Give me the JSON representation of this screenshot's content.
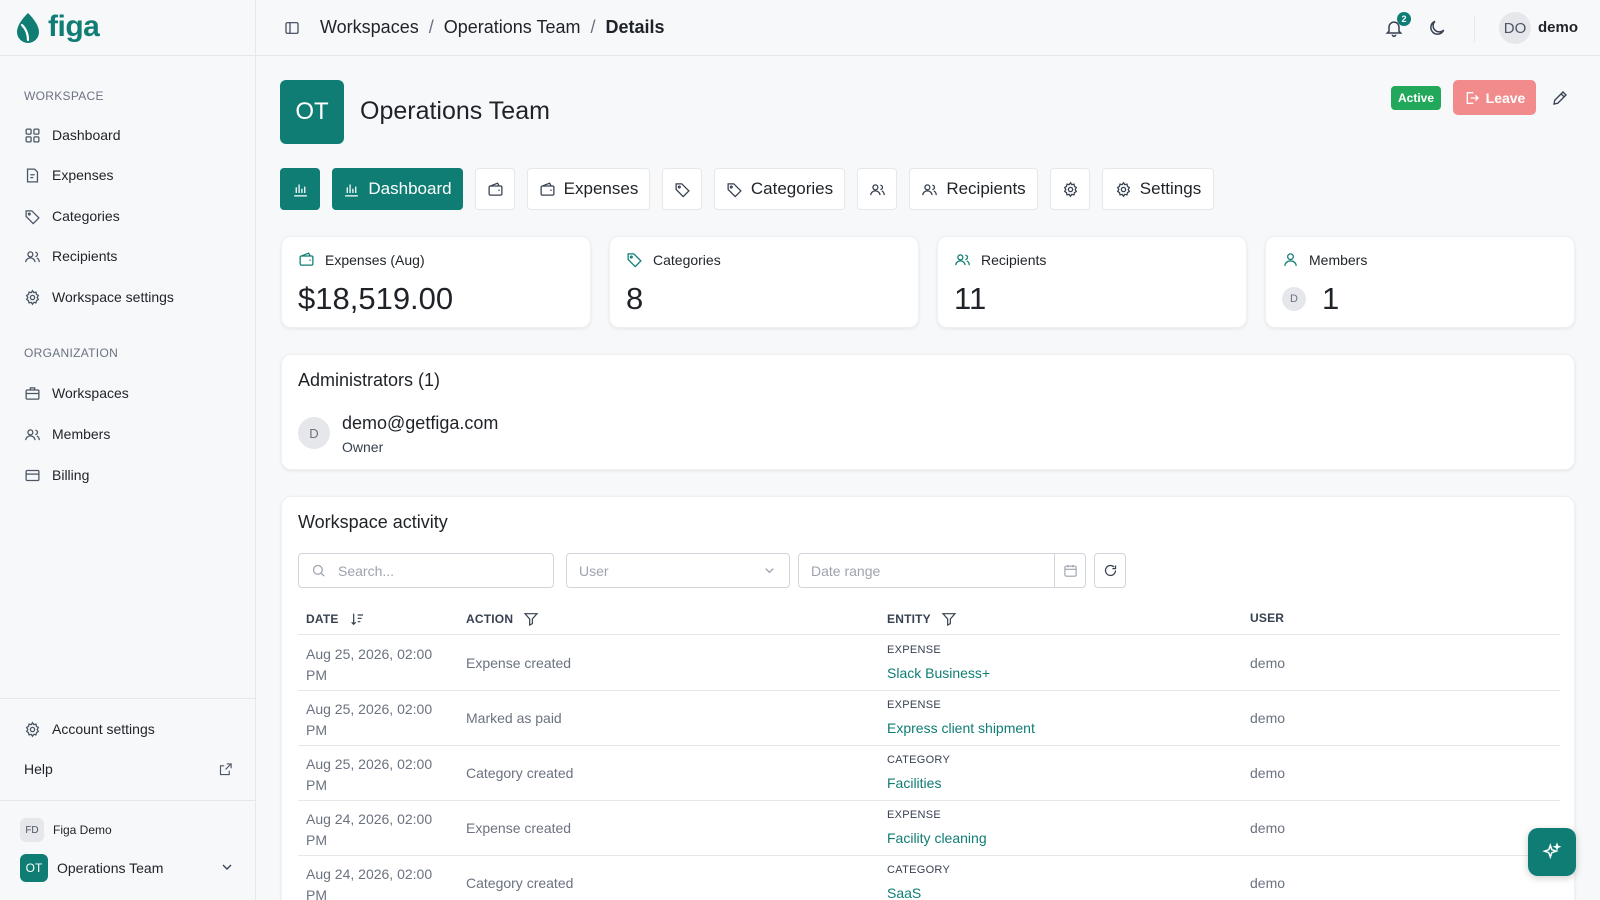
{
  "app": {
    "name": "figa"
  },
  "sidebar": {
    "workspace_section": "WORKSPACE",
    "workspace_items": [
      {
        "label": "Dashboard",
        "icon": "grid-icon"
      },
      {
        "label": "Expenses",
        "icon": "receipt-icon"
      },
      {
        "label": "Categories",
        "icon": "tag-icon"
      },
      {
        "label": "Recipients",
        "icon": "users-icon"
      },
      {
        "label": "Workspace settings",
        "icon": "gear-icon"
      }
    ],
    "organization_section": "ORGANIZATION",
    "organization_items": [
      {
        "label": "Workspaces",
        "icon": "briefcase-icon"
      },
      {
        "label": "Members",
        "icon": "users-icon"
      },
      {
        "label": "Billing",
        "icon": "credit-card-icon"
      }
    ],
    "account_settings": "Account settings",
    "help": "Help",
    "org": {
      "initials": "FD",
      "name": "Figa Demo"
    },
    "current_workspace": {
      "initials": "OT",
      "name": "Operations Team"
    }
  },
  "topbar": {
    "breadcrumbs": [
      "Workspaces",
      "Operations Team",
      "Details"
    ],
    "separator": "/",
    "notification_count": "2",
    "user_initials": "DO",
    "user_name": "demo"
  },
  "header": {
    "initials": "OT",
    "title": "Operations Team",
    "status": "Active",
    "leave_label": "Leave"
  },
  "tabs": [
    {
      "label": "Dashboard",
      "active": true
    },
    {
      "label": "Expenses",
      "active": false
    },
    {
      "label": "Categories",
      "active": false
    },
    {
      "label": "Recipients",
      "active": false
    },
    {
      "label": "Settings",
      "active": false
    }
  ],
  "stats": [
    {
      "label": "Expenses (Aug)",
      "value": "$18,519.00",
      "icon": "wallet-icon"
    },
    {
      "label": "Categories",
      "value": "8",
      "icon": "tag-icon"
    },
    {
      "label": "Recipients",
      "value": "11",
      "icon": "users-icon"
    },
    {
      "label": "Members",
      "value": "1",
      "icon": "user-icon",
      "avatar": "D"
    }
  ],
  "administrators": {
    "title": "Administrators (1)",
    "items": [
      {
        "initial": "D",
        "email": "demo@getfiga.com",
        "role": "Owner"
      }
    ]
  },
  "activity": {
    "title": "Workspace activity",
    "search_placeholder": "Search...",
    "user_placeholder": "User",
    "date_placeholder": "Date range",
    "columns": {
      "date": "DATE",
      "action": "ACTION",
      "entity": "ENTITY",
      "user": "USER"
    },
    "rows": [
      {
        "date": "Aug 25, 2026, 02:00 PM",
        "action": "Expense created",
        "entity_type": "EXPENSE",
        "entity": "Slack Business+",
        "user": "demo"
      },
      {
        "date": "Aug 25, 2026, 02:00 PM",
        "action": "Marked as paid",
        "entity_type": "EXPENSE",
        "entity": "Express client shipment",
        "user": "demo"
      },
      {
        "date": "Aug 25, 2026, 02:00 PM",
        "action": "Category created",
        "entity_type": "CATEGORY",
        "entity": "Facilities",
        "user": "demo"
      },
      {
        "date": "Aug 24, 2026, 02:00 PM",
        "action": "Expense created",
        "entity_type": "EXPENSE",
        "entity": "Facility cleaning",
        "user": "demo"
      },
      {
        "date": "Aug 24, 2026, 02:00 PM",
        "action": "Category created",
        "entity_type": "CATEGORY",
        "entity": "SaaS",
        "user": "demo"
      }
    ]
  },
  "colors": {
    "brand": "#0f7d74",
    "active_badge": "#22a85a",
    "leave": "#f28b8b"
  }
}
